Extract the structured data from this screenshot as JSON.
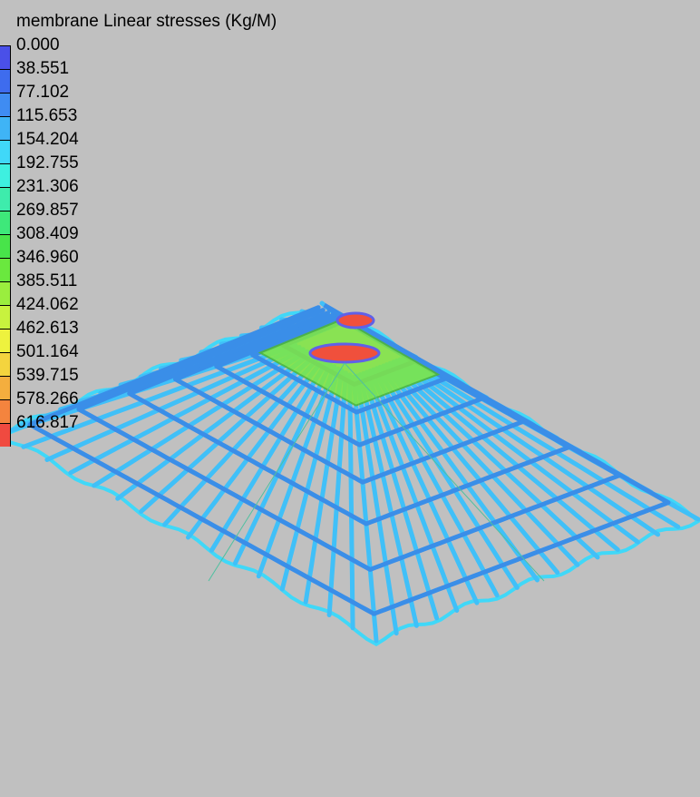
{
  "legend": {
    "title": "membrane Linear stresses (Kg/M)",
    "entries": [
      {
        "label": "0.000",
        "color": "#4a50e8"
      },
      {
        "label": "38.551",
        "color": "#3e6cee"
      },
      {
        "label": "77.102",
        "color": "#3f8cf2"
      },
      {
        "label": "115.653",
        "color": "#3fb4f6"
      },
      {
        "label": "154.204",
        "color": "#40d8f8"
      },
      {
        "label": "192.755",
        "color": "#3ef0e0"
      },
      {
        "label": "231.306",
        "color": "#3eecac"
      },
      {
        "label": "269.857",
        "color": "#3ee87a"
      },
      {
        "label": "308.409",
        "color": "#48e44a"
      },
      {
        "label": "346.960",
        "color": "#6ae83e"
      },
      {
        "label": "385.511",
        "color": "#9aee3e"
      },
      {
        "label": "424.062",
        "color": "#c8f23e"
      },
      {
        "label": "462.613",
        "color": "#eef23e"
      },
      {
        "label": "501.164",
        "color": "#f4d43e"
      },
      {
        "label": "539.715",
        "color": "#f4ae3e"
      },
      {
        "label": "578.266",
        "color": "#f4843e"
      },
      {
        "label": "616.817",
        "color": "#f04a40"
      }
    ]
  },
  "scene": {
    "background": "#c0c0c0",
    "surface": "tensile membrane mesh with central mast",
    "colors": {
      "rings": "#3a8ee8",
      "radial_main": "#40c0f8",
      "edge": "#40d8f8",
      "cone": "#80e840",
      "cone_dark": "#50b830",
      "mast_cap": "#f0503c",
      "mast_ring": "#6060e8",
      "outline": "#000000"
    }
  }
}
